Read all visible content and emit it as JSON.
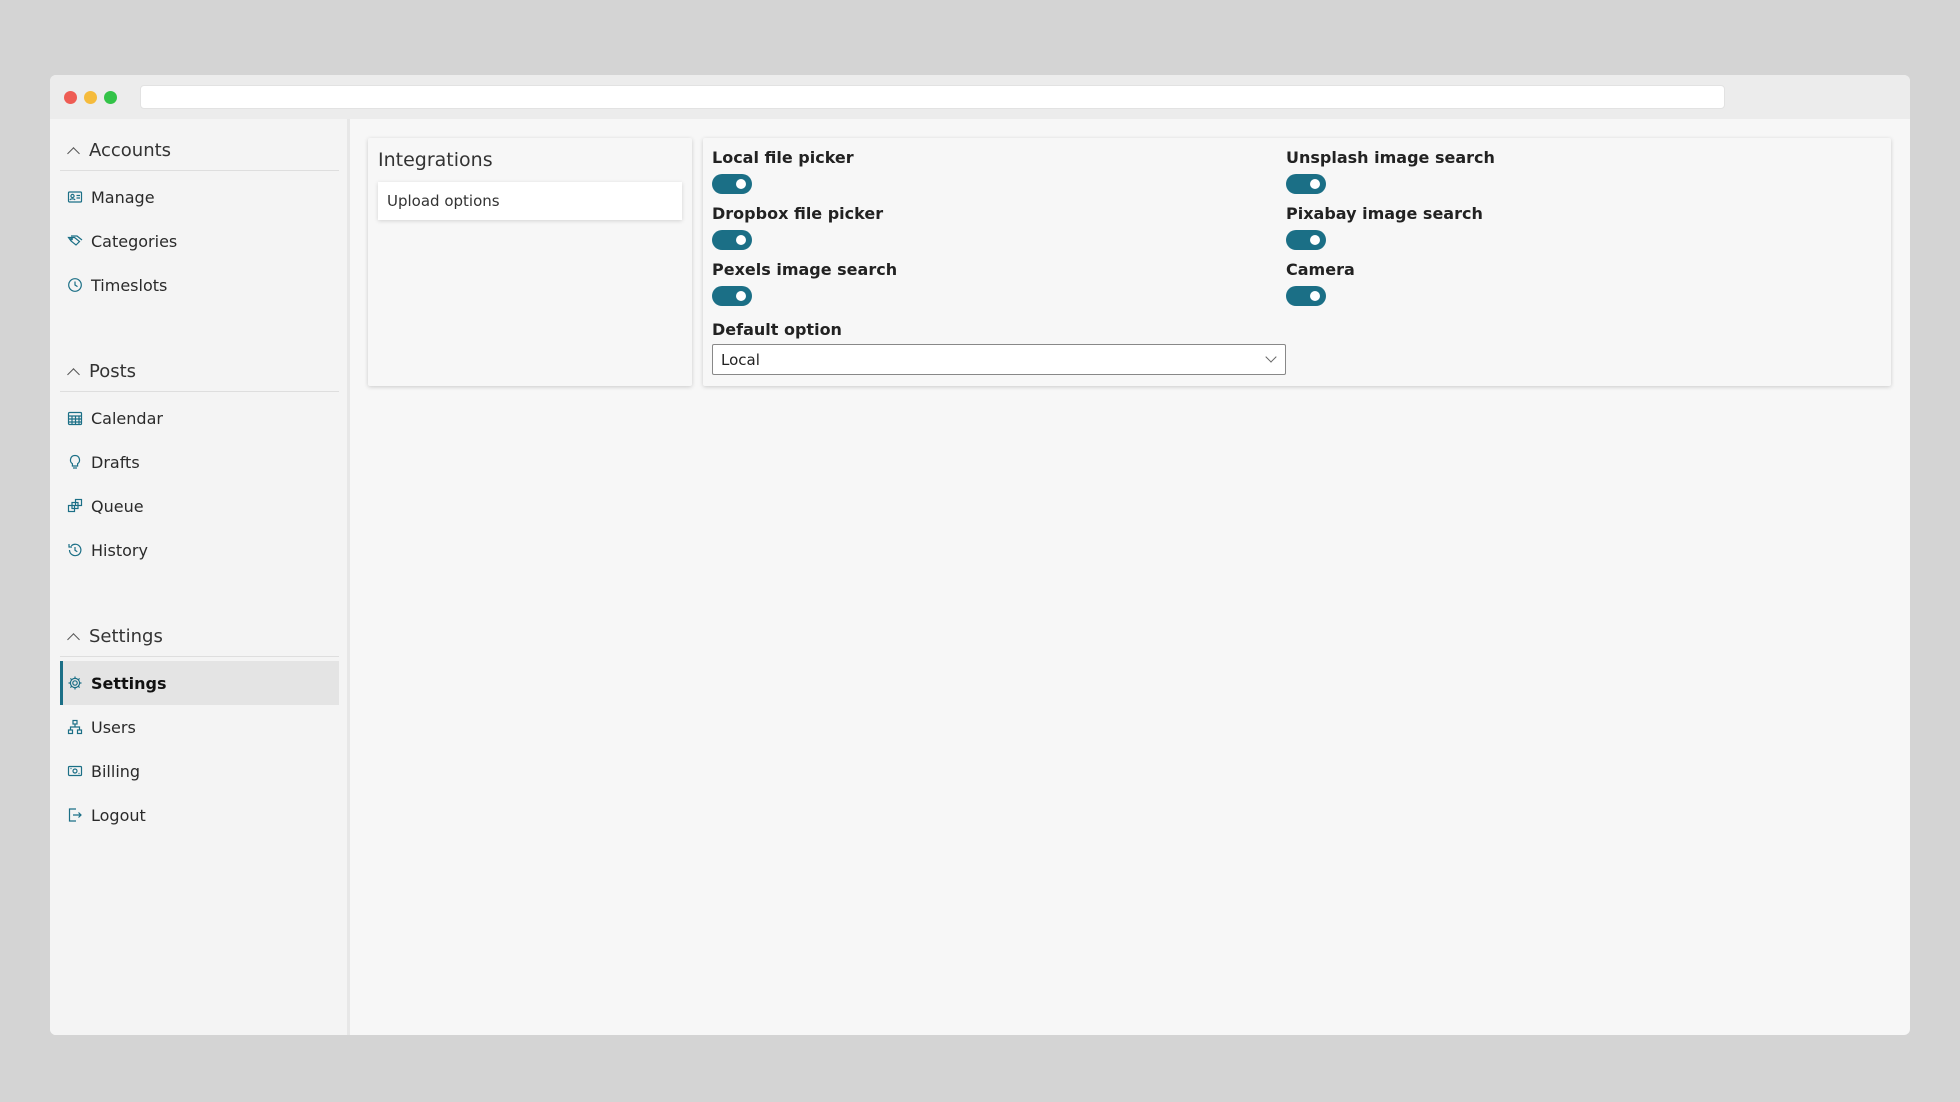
{
  "sidebar": {
    "sections": [
      {
        "title": "Accounts",
        "items": [
          {
            "label": "Manage",
            "icon": "id-card-icon"
          },
          {
            "label": "Categories",
            "icon": "tags-icon"
          },
          {
            "label": "Timeslots",
            "icon": "clock-icon"
          }
        ]
      },
      {
        "title": "Posts",
        "items": [
          {
            "label": "Calendar",
            "icon": "calendar-icon"
          },
          {
            "label": "Drafts",
            "icon": "lightbulb-icon"
          },
          {
            "label": "Queue",
            "icon": "queue-icon"
          },
          {
            "label": "History",
            "icon": "history-icon"
          }
        ]
      },
      {
        "title": "Settings",
        "items": [
          {
            "label": "Settings",
            "icon": "gear-icon",
            "active": true
          },
          {
            "label": "Users",
            "icon": "users-icon"
          },
          {
            "label": "Billing",
            "icon": "billing-icon"
          },
          {
            "label": "Logout",
            "icon": "logout-icon"
          }
        ]
      }
    ]
  },
  "integrations": {
    "title": "Integrations",
    "sub_item": "Upload options"
  },
  "upload_options": {
    "toggles": [
      {
        "label": "Local file picker",
        "on": true
      },
      {
        "label": "Unsplash image search",
        "on": true
      },
      {
        "label": "Dropbox file picker",
        "on": true
      },
      {
        "label": "Pixabay image search",
        "on": true
      },
      {
        "label": "Pexels image search",
        "on": true
      },
      {
        "label": "Camera",
        "on": true
      }
    ],
    "default_option": {
      "label": "Default option",
      "value": "Local"
    }
  },
  "colors": {
    "accent": "#1b6f86",
    "active_bg": "#e4e4e4"
  }
}
